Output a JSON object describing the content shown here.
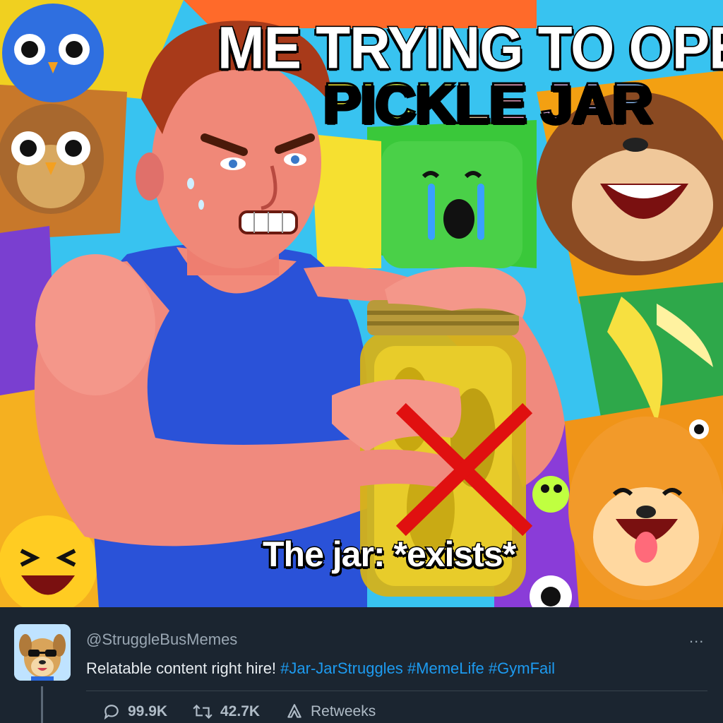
{
  "meme": {
    "caption_top_line1": "ME TRYING TO OPEN THE",
    "caption_top_line2": "PICKLE JAR",
    "caption_jar": "The jar: *exists*"
  },
  "tweet": {
    "handle": "@StruggleBusMemes",
    "text": "Relatable content right hire! ",
    "hashtags": [
      "#Jar-JarStruggles",
      "#MemeLife",
      "#GymFail"
    ],
    "more_icon": "...",
    "actions": {
      "reply_count": "99.9K",
      "retweet_count": "42.7K",
      "retweeks_label": "Retweeks"
    }
  },
  "colors": {
    "background": "#1b2530",
    "hashtag": "#1d9bf0",
    "handle": "#9aa7b3",
    "text": "#e7ecf0"
  }
}
